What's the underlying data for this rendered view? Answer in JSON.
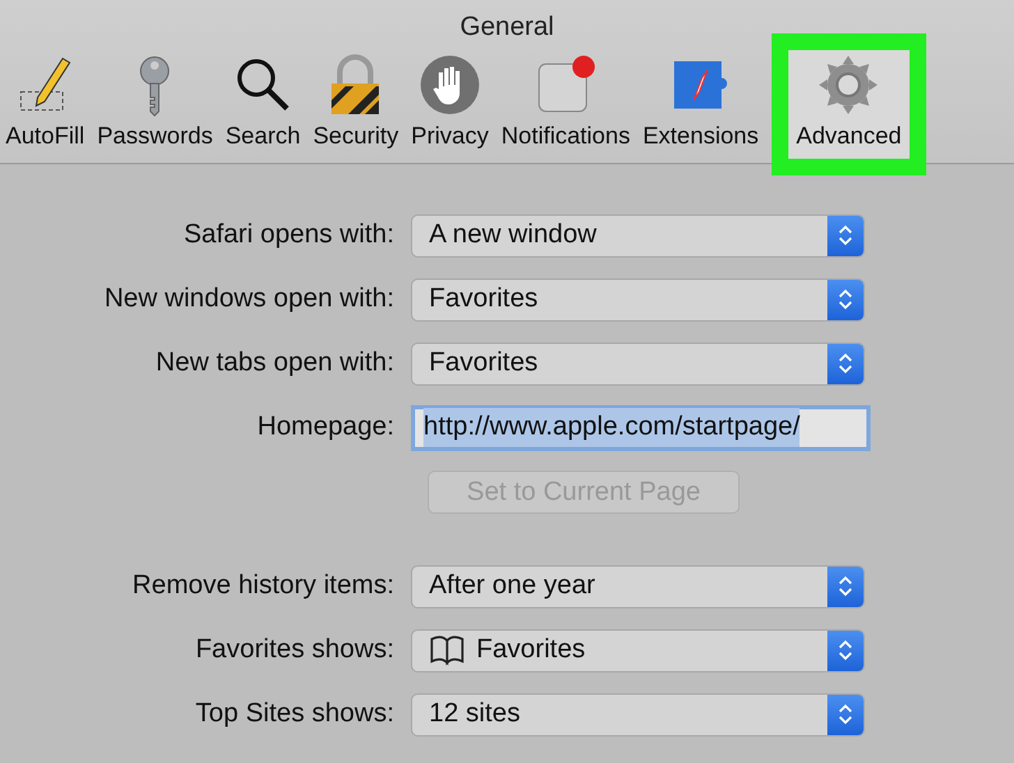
{
  "window": {
    "title": "General"
  },
  "toolbar": [
    {
      "label": "AutoFill",
      "selected": false,
      "highlighted": false
    },
    {
      "label": "Passwords",
      "selected": false,
      "highlighted": false
    },
    {
      "label": "Search",
      "selected": false,
      "highlighted": false
    },
    {
      "label": "Security",
      "selected": false,
      "highlighted": false
    },
    {
      "label": "Privacy",
      "selected": false,
      "highlighted": false
    },
    {
      "label": "Notifications",
      "selected": false,
      "highlighted": false
    },
    {
      "label": "Extensions",
      "selected": false,
      "highlighted": false
    },
    {
      "label": "Advanced",
      "selected": true,
      "highlighted": true
    }
  ],
  "groups": [
    [
      {
        "kind": "select",
        "label": "Safari opens with:",
        "value": "A new window"
      },
      {
        "kind": "select",
        "label": "New windows open with:",
        "value": "Favorites"
      },
      {
        "kind": "select",
        "label": "New tabs open with:",
        "value": "Favorites"
      },
      {
        "kind": "field",
        "label": "Homepage:",
        "value": "http://www.apple.com/startpage/",
        "focused": true
      },
      {
        "kind": "button",
        "label": "Set to Current Page",
        "disabled": true
      }
    ],
    [
      {
        "kind": "select",
        "label": "Remove history items:",
        "value": "After one year"
      },
      {
        "kind": "bookmarks-select",
        "label": "Favorites shows:",
        "value": "Favorites"
      },
      {
        "kind": "select",
        "label": "Top Sites shows:",
        "value": "12 sites"
      }
    ]
  ]
}
